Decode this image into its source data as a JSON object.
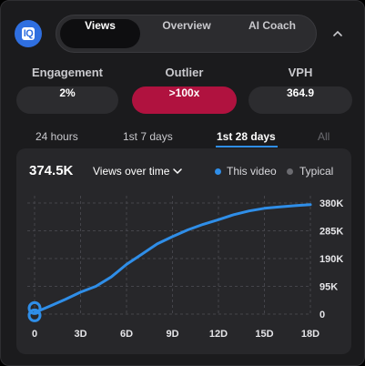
{
  "app": {
    "logo_text": "IQ"
  },
  "tabs": [
    {
      "label": "Views",
      "active": true
    },
    {
      "label": "Overview",
      "active": false
    },
    {
      "label": "AI Coach",
      "active": false
    }
  ],
  "metrics": [
    {
      "label": "Engagement",
      "value": "2%"
    },
    {
      "label": "Outlier",
      "value": ">100x"
    },
    {
      "label": "VPH",
      "value": "364.9"
    }
  ],
  "ranges": [
    {
      "label": "24 hours",
      "active": false
    },
    {
      "label": "1st 7 days",
      "active": false
    },
    {
      "label": "1st 28 days",
      "active": true
    },
    {
      "label": "All",
      "active": false
    }
  ],
  "card": {
    "total": "374.5K",
    "metric_select": "Views over time",
    "legend": [
      {
        "name": "This video",
        "color": "#2f8ee8"
      },
      {
        "name": "Typical",
        "color": "#6b6b70"
      }
    ]
  },
  "colors": {
    "accent": "#2f8ee8",
    "outlier": "#b0123f"
  },
  "chart_data": {
    "type": "line",
    "title": "",
    "xlabel": "",
    "ylabel": "",
    "x_ticks": [
      "0",
      "3D",
      "6D",
      "9D",
      "12D",
      "15D",
      "18D"
    ],
    "y_ticks": [
      "0",
      "95K",
      "190K",
      "285K",
      "380K"
    ],
    "xlim": [
      0,
      18
    ],
    "ylim": [
      0,
      380000
    ],
    "grid": true,
    "series": [
      {
        "name": "This video",
        "x": [
          0,
          1,
          2,
          3,
          4,
          5,
          6,
          7,
          8,
          9,
          10,
          11,
          12,
          13,
          14,
          15,
          16,
          17,
          18
        ],
        "y": [
          5000,
          27000,
          50000,
          75000,
          95000,
          127000,
          170000,
          205000,
          240000,
          265000,
          288000,
          307000,
          323000,
          340000,
          353000,
          362000,
          367000,
          371000,
          374500
        ]
      }
    ]
  }
}
